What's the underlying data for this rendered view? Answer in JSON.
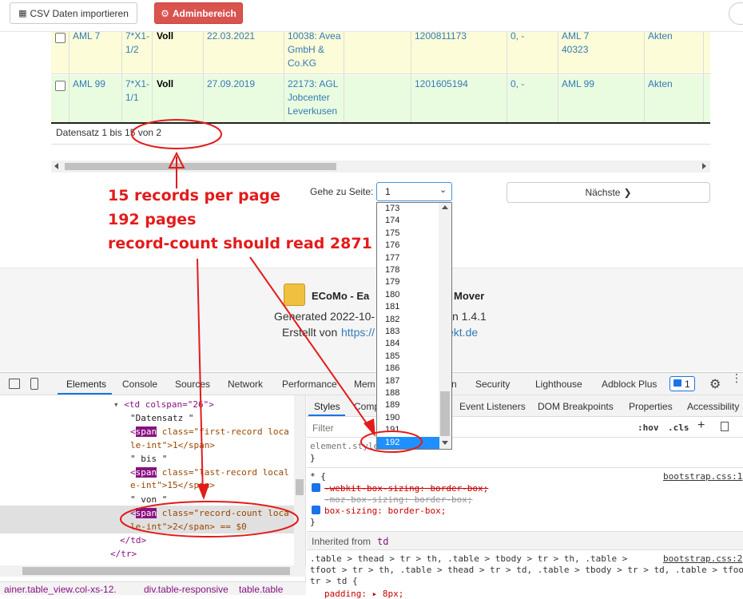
{
  "toolbar": {
    "csv_label": "CSV Daten importieren",
    "admin_label": "Adminbereich"
  },
  "table": {
    "rows": [
      {
        "c1": "AML 7",
        "c2": "7*X1-1/2",
        "c3": "Voll",
        "c4": "22.03.2021",
        "c5": "10038: Avea GmbH & Co.KG",
        "c6": "1200811173",
        "c7": "0, -",
        "c8": "AML 7 40323",
        "c9": "Akten"
      },
      {
        "c1": "AML 99",
        "c2": "7*X1-1/1",
        "c3": "Voll",
        "c4": "27.09.2019",
        "c5": "22173: AGL Jobcenter Leverkusen",
        "c6": "1201605194",
        "c7": "0, -",
        "c8": "AML 99",
        "c9": "Akten"
      }
    ],
    "footer_text": "Datensatz 1 bis 15 von 2"
  },
  "pagination": {
    "goto_label": "Gehe zu Seite:",
    "selected_page": "1",
    "next_label": "Nächste",
    "options": [
      "173",
      "174",
      "175",
      "176",
      "177",
      "178",
      "179",
      "180",
      "181",
      "182",
      "183",
      "184",
      "185",
      "186",
      "187",
      "188",
      "189",
      "190",
      "191",
      "192"
    ],
    "highlighted": "192"
  },
  "annotation": {
    "line1": "15 records per page",
    "line2": "192 pages",
    "line3": "record-count should read 2871"
  },
  "footer": {
    "app_name": "ECoMo - Ea",
    "app_name_end": "Mover",
    "generated": "Generated 2022-10-",
    "generated_end": "n 1.4.1",
    "created_by": "Erstellt von",
    "link_start": "https://",
    "link_end": "ekt.de"
  },
  "devtools": {
    "tabs": [
      "Elements",
      "Console",
      "Sources",
      "Network",
      "Performance",
      "Mem",
      "n",
      "Security",
      "Lighthouse",
      "Adblock Plus"
    ],
    "badge_count": "1",
    "styles_tabs": [
      "Styles",
      "Comp",
      "Event Listeners",
      "DOM Breakpoints",
      "Properties",
      "Accessibility"
    ],
    "filter_placeholder": "Filter",
    "hov": ":hov",
    "cls": ".cls",
    "elements": {
      "l1_tag": "<td colspan=\"26\">",
      "l2": "\"Datensatz \"",
      "l3a": "<",
      "l3span": "span",
      "l3b": " class=\"first-record loca",
      "l4": "le-int\">1</span>",
      "l5": "\" bis \"",
      "l6b": " class=\"last-record local",
      "l7": "e-int\">15</span>",
      "l8": "\" von \"",
      "l9b": " class=\"record-count loca",
      "l10": "le-int\">2</span> == $0",
      "l11": "</td>",
      "l12": "</tr>"
    },
    "styles": {
      "element_style": "element.style",
      "brace_close": "}",
      "star": "* {",
      "source1": "bootstrap.css:1",
      "rule1": "-webkit-box-sizing: border-box;",
      "rule2": "-moz-box-sizing: border-box;",
      "rule3": "box-sizing: border-box;",
      "inherited": "Inherited from",
      "inherited_tag": "td",
      "selector1": ".table > thead > tr > th, .table > tbody > tr > th, .table >",
      "source2": "bootstrap.css:2",
      "selector2": "tfoot > tr > th, .table > thead > tr > td, .table > tbody > tr > td, .table > tfoot >",
      "selector3": "tr > td {",
      "padding": "padding: ▸ 8px;"
    },
    "breadcrumb": [
      "ainer.table_view.col-xs-12.",
      "div.table-responsive",
      "table.table"
    ]
  }
}
